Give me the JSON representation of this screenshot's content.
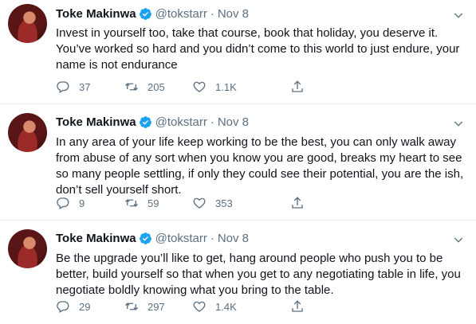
{
  "tweets": [
    {
      "author": {
        "name": "Toke Makinwa",
        "handle": "@tokstarr"
      },
      "date": "Nov 8",
      "text": "Invest in yourself too, take that course, book that holiday, you deserve it. You’ve worked so hard and you didn’t come to this world to just endure, your name is not endurance",
      "replies": "37",
      "retweets": "205",
      "likes": "1.1K"
    },
    {
      "author": {
        "name": "Toke Makinwa",
        "handle": "@tokstarr"
      },
      "date": "Nov 8",
      "text": "In any area of your life keep working to be the best, you can only walk away from abuse of any sort when you know you are good, breaks my heart to see so many people settling, if only they could see their potential, you are the ish, don’t sell yourself short.",
      "replies": "9",
      "retweets": "59",
      "likes": "353"
    },
    {
      "author": {
        "name": "Toke Makinwa",
        "handle": "@tokstarr"
      },
      "date": "Nov 8",
      "text": "Be the upgrade you’ll like to get, hang around people who push you to be better, build yourself so that when you get to any negotiating table in life, you negotiate boldly knowing what you bring to the table.",
      "replies": "29",
      "retweets": "297",
      "likes": "1.4K"
    }
  ],
  "separator": "·",
  "colors": {
    "verified": "#1da1f2",
    "muted": "#5b7083",
    "text": "#0f1419",
    "border": "#e6ecf0"
  },
  "icons": [
    "verified-badge-icon",
    "caret-down-icon",
    "reply-icon",
    "retweet-icon",
    "like-icon",
    "share-icon"
  ]
}
